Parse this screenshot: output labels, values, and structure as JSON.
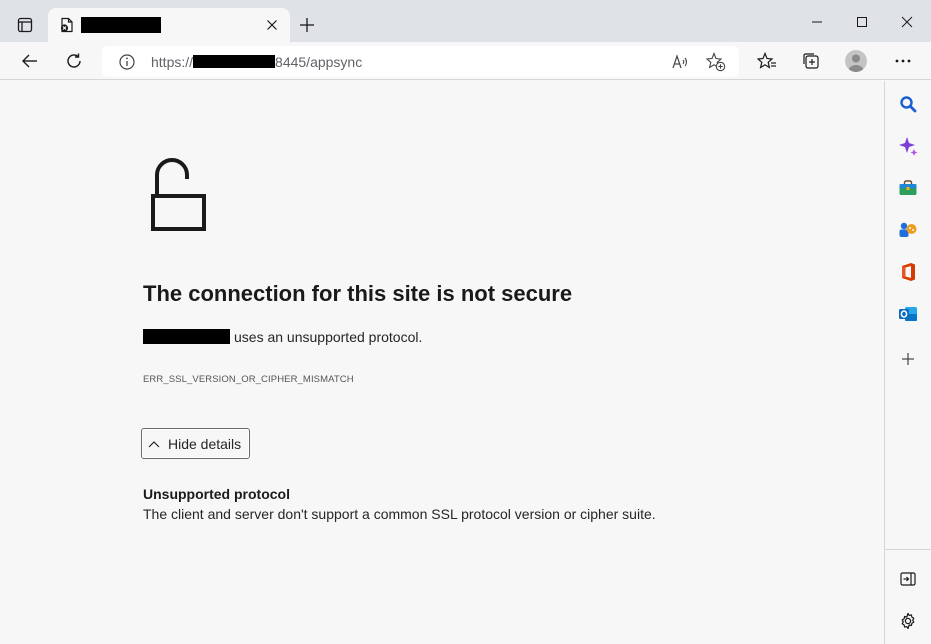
{
  "tab": {
    "title": "redacted"
  },
  "address_bar": {
    "url_prefix": "https://",
    "url_host": "redacted",
    "url_suffix": "8445/appsync"
  },
  "page": {
    "title": "The connection for this site is not secure",
    "host": "redacted",
    "description": "uses an unsupported protocol.",
    "error_code": "ERR_SSL_VERSION_OR_CIPHER_MISMATCH",
    "details_button_label": "Hide details",
    "detail_heading": "Unsupported protocol",
    "detail_body": "The client and server don't support a common SSL protocol version or cipher suite."
  },
  "icons": {
    "tab_actions": "tab-actions-icon",
    "favicon": "broken-page-icon",
    "close": "close-icon",
    "new_tab": "plus-icon",
    "minimize": "minimize-icon",
    "maximize": "maximize-icon",
    "window_close": "close-icon",
    "back": "back-arrow-icon",
    "reload": "reload-icon",
    "info": "info-icon",
    "read_aloud": "read-aloud-icon",
    "add_favorite": "star-plus-icon",
    "favorites": "favorites-icon",
    "collections": "collections-icon",
    "profile": "profile-icon",
    "more": "more-icon",
    "search": "search-icon",
    "copilot": "sparkle-icon",
    "shopping": "shopping-bag-icon",
    "games": "games-icon",
    "office": "office-icon",
    "outlook": "outlook-icon",
    "add": "plus-icon",
    "hide_sidebar": "sidebar-collapse-icon",
    "settings": "gear-icon",
    "lock": "unlocked-padlock-icon"
  },
  "colors": {
    "search_blue": "#1a5fd6",
    "copilot_purple": "#7b3fd4",
    "office_red": "#d83b01",
    "outlook_blue": "#0f6cbd"
  }
}
